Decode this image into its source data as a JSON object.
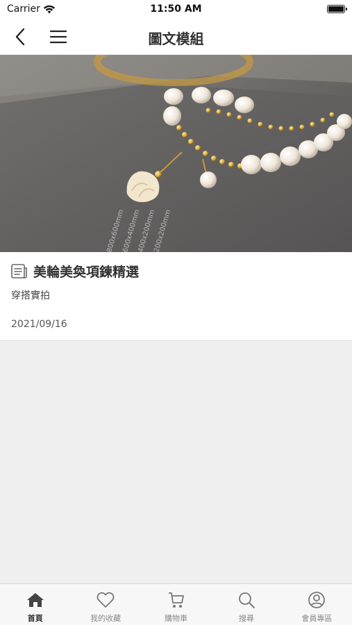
{
  "status_bar": {
    "carrier": "Carrier",
    "time": "11:50 AM"
  },
  "nav": {
    "title": "圖文模組"
  },
  "hero": {
    "watermark_lines": [
      "800x600mm",
      "600x400mm",
      "400x200mm",
      "200x200mm"
    ]
  },
  "card": {
    "title": "美輪美奐項鍊精選",
    "subtitle": "穿搭實拍",
    "date": "2021/09/16"
  },
  "tabs": [
    {
      "label": "首頁",
      "icon": "home-icon",
      "active": true
    },
    {
      "label": "我的收藏",
      "icon": "heart-icon",
      "active": false
    },
    {
      "label": "購物車",
      "icon": "cart-icon",
      "active": false
    },
    {
      "label": "搜尋",
      "icon": "search-icon",
      "active": false
    },
    {
      "label": "會員專區",
      "icon": "user-icon",
      "active": false
    }
  ],
  "colors": {
    "tab_active": "#333333",
    "tab_inactive": "#8a8a8a",
    "background": "#efefef"
  }
}
